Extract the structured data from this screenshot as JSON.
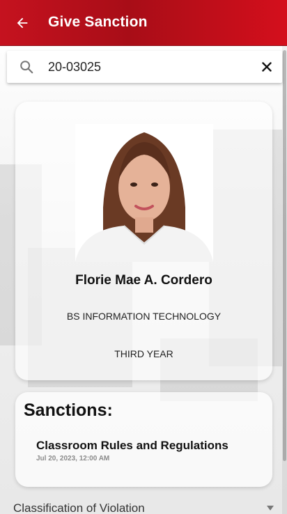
{
  "app_bar": {
    "title": "Give Sanction",
    "back_icon": "arrow-left-icon",
    "color": "#c5121f"
  },
  "search": {
    "value": "20-03025",
    "icon": "search-icon",
    "clear_icon": "close-icon"
  },
  "student": {
    "name": "Florie Mae A. Cordero",
    "course": "BS INFORMATION TECHNOLOGY",
    "year": "THIRD YEAR"
  },
  "sanctions": {
    "heading": "Sanctions:",
    "items": [
      {
        "title": "Classroom Rules and Regulations",
        "date": "Jul 20, 2023, 12:00 AM"
      }
    ]
  },
  "violation_select": {
    "label": "Classification of Violation",
    "icon": "chevron-down-icon"
  }
}
